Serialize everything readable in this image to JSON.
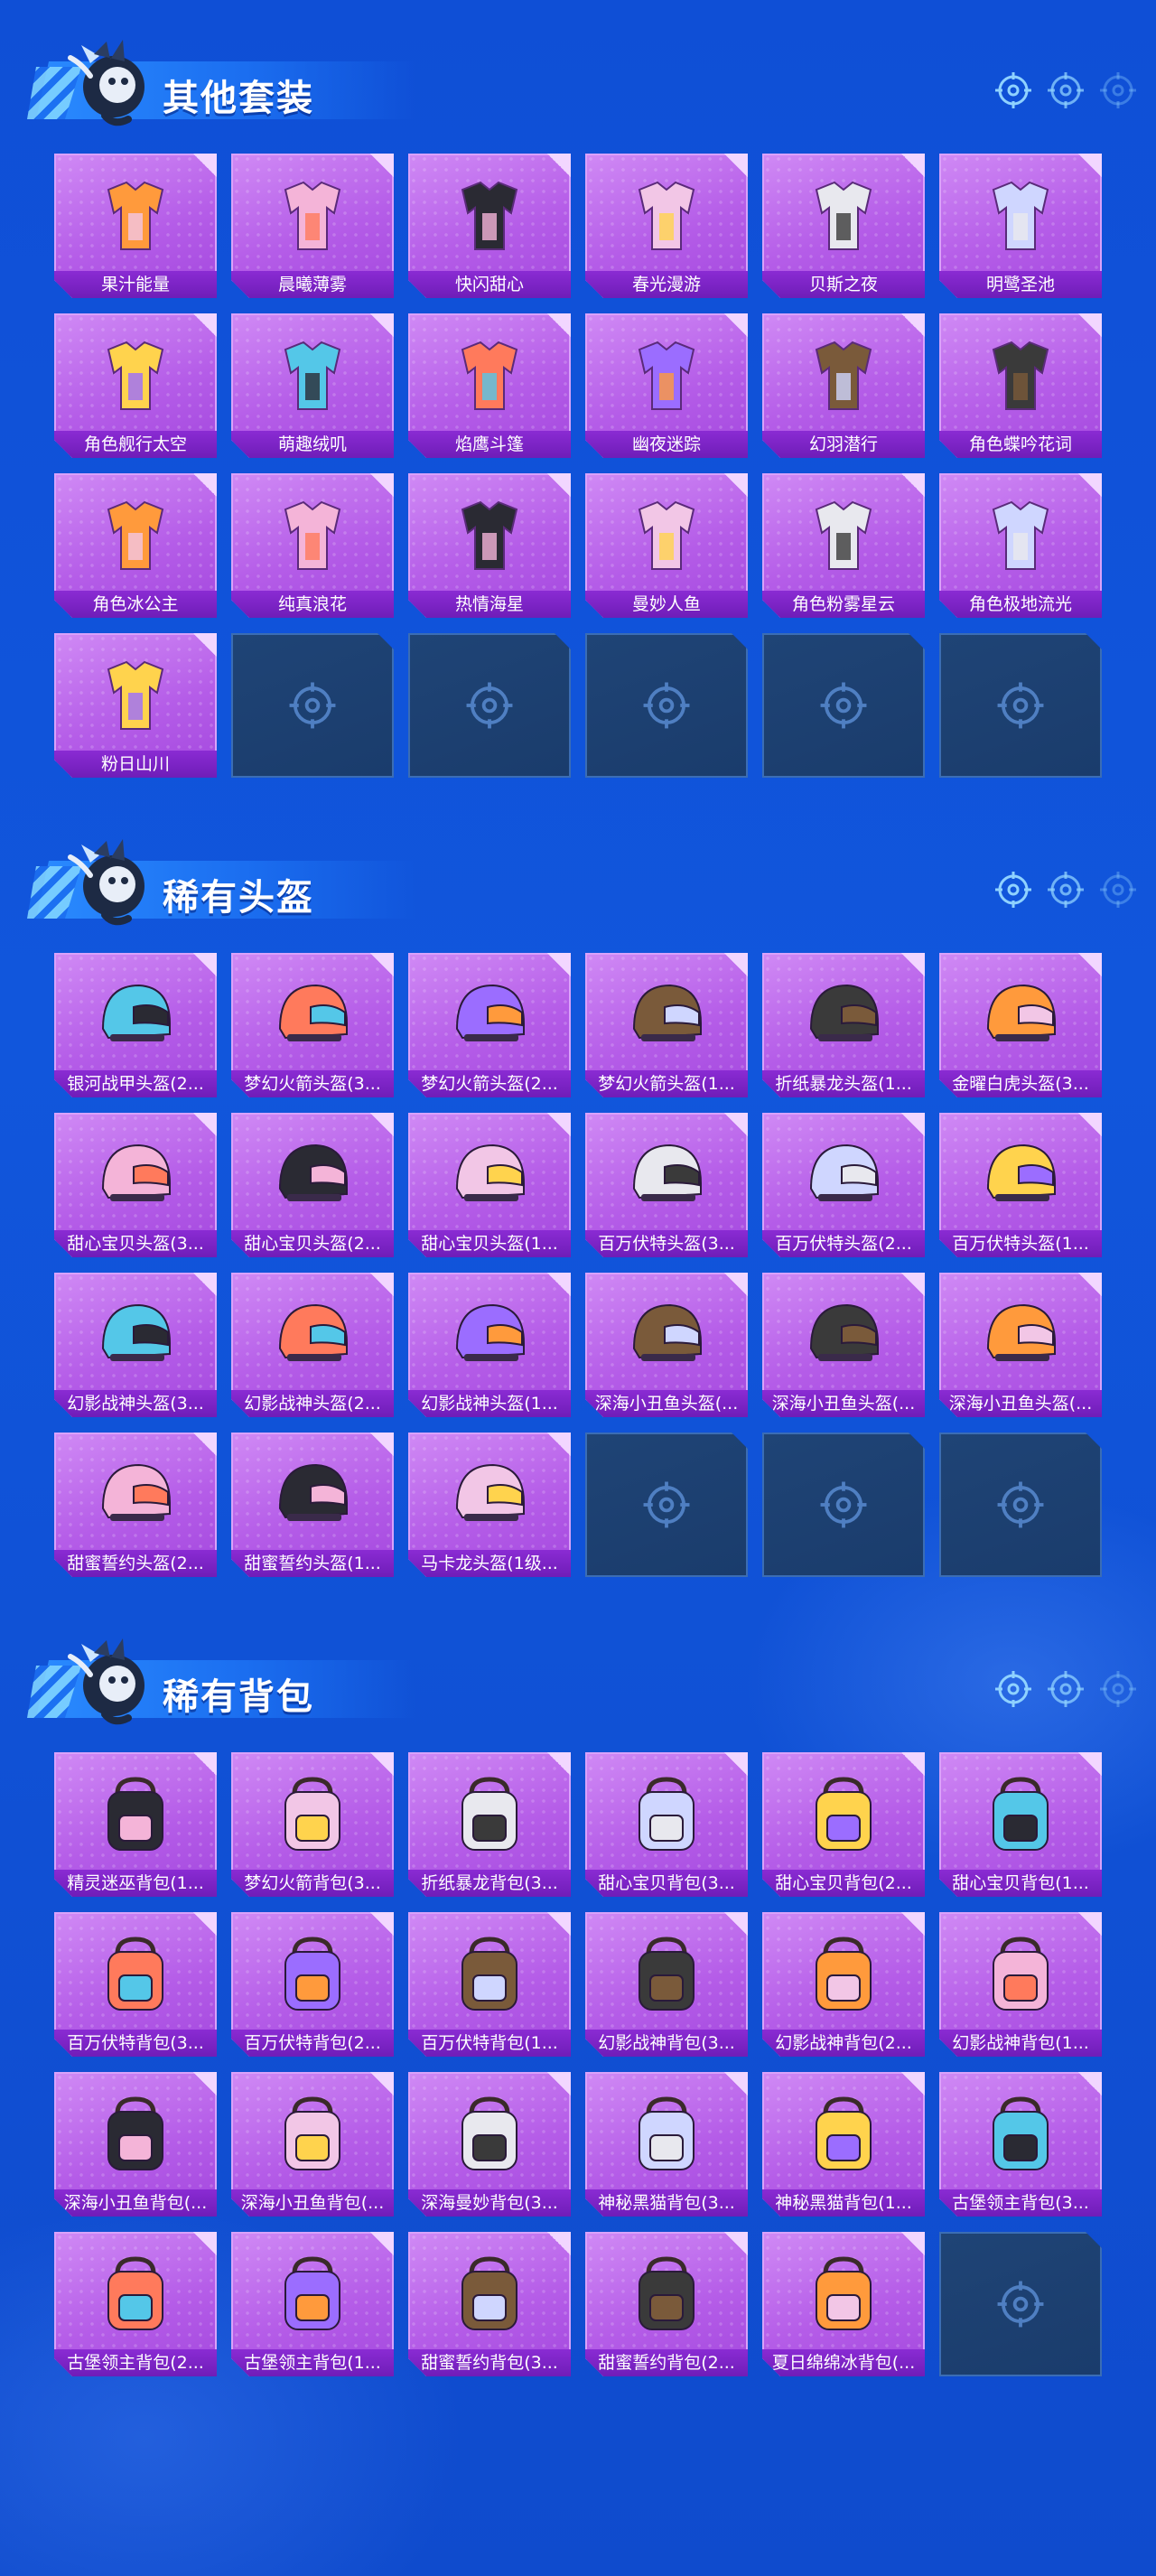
{
  "colors": {
    "background": "#1156dc",
    "tile": "#b55de8",
    "label": "#7a22c4",
    "empty": "#1e4273",
    "title": "#ffffff"
  },
  "sections": [
    {
      "title": "其他套装",
      "kind": "outfit",
      "items": [
        "果汁能量",
        "晨曦薄雾",
        "快闪甜心",
        "春光漫游",
        "贝斯之夜",
        "明鹭圣池",
        "角色舰行太空",
        "萌趣绒叽",
        "焰鹰斗篷",
        "幽夜迷踪",
        "幻羽潜行",
        "角色蝶吟花词",
        "角色冰公主",
        "纯真浪花",
        "热情海星",
        "曼妙人鱼",
        "角色粉雾星云",
        "角色极地流光",
        "粉日山川"
      ],
      "empty_slots": 5
    },
    {
      "title": "稀有头盔",
      "kind": "helmet",
      "items": [
        "银河战甲头盔(2...",
        "梦幻火箭头盔(3...",
        "梦幻火箭头盔(2...",
        "梦幻火箭头盔(1...",
        "折纸暴龙头盔(1...",
        "金曜白虎头盔(3...",
        "甜心宝贝头盔(3...",
        "甜心宝贝头盔(2...",
        "甜心宝贝头盔(1...",
        "百万伏特头盔(3...",
        "百万伏特头盔(2...",
        "百万伏特头盔(1...",
        "幻影战神头盔(3...",
        "幻影战神头盔(2...",
        "幻影战神头盔(1...",
        "深海小丑鱼头盔(...",
        "深海小丑鱼头盔(...",
        "深海小丑鱼头盔(...",
        "甜蜜誓约头盔(2...",
        "甜蜜誓约头盔(1...",
        "马卡龙头盔(1级..."
      ],
      "empty_slots": 3
    },
    {
      "title": "稀有背包",
      "kind": "backpack",
      "items": [
        "精灵迷巫背包(1...",
        "梦幻火箭背包(3...",
        "折纸暴龙背包(3...",
        "甜心宝贝背包(3...",
        "甜心宝贝背包(2...",
        "甜心宝贝背包(1...",
        "百万伏特背包(3...",
        "百万伏特背包(2...",
        "百万伏特背包(1...",
        "幻影战神背包(3...",
        "幻影战神背包(2...",
        "幻影战神背包(1...",
        "深海小丑鱼背包(...",
        "深海小丑鱼背包(...",
        "深海曼妙背包(3...",
        "神秘黑猫背包(3...",
        "神秘黑猫背包(1...",
        "古堡领主背包(3...",
        "古堡领主背包(2...",
        "古堡领主背包(1...",
        "甜蜜誓约背包(3...",
        "甜蜜誓约背包(2...",
        "夏日绵绵冰背包(..."
      ],
      "empty_slots": 1
    }
  ]
}
